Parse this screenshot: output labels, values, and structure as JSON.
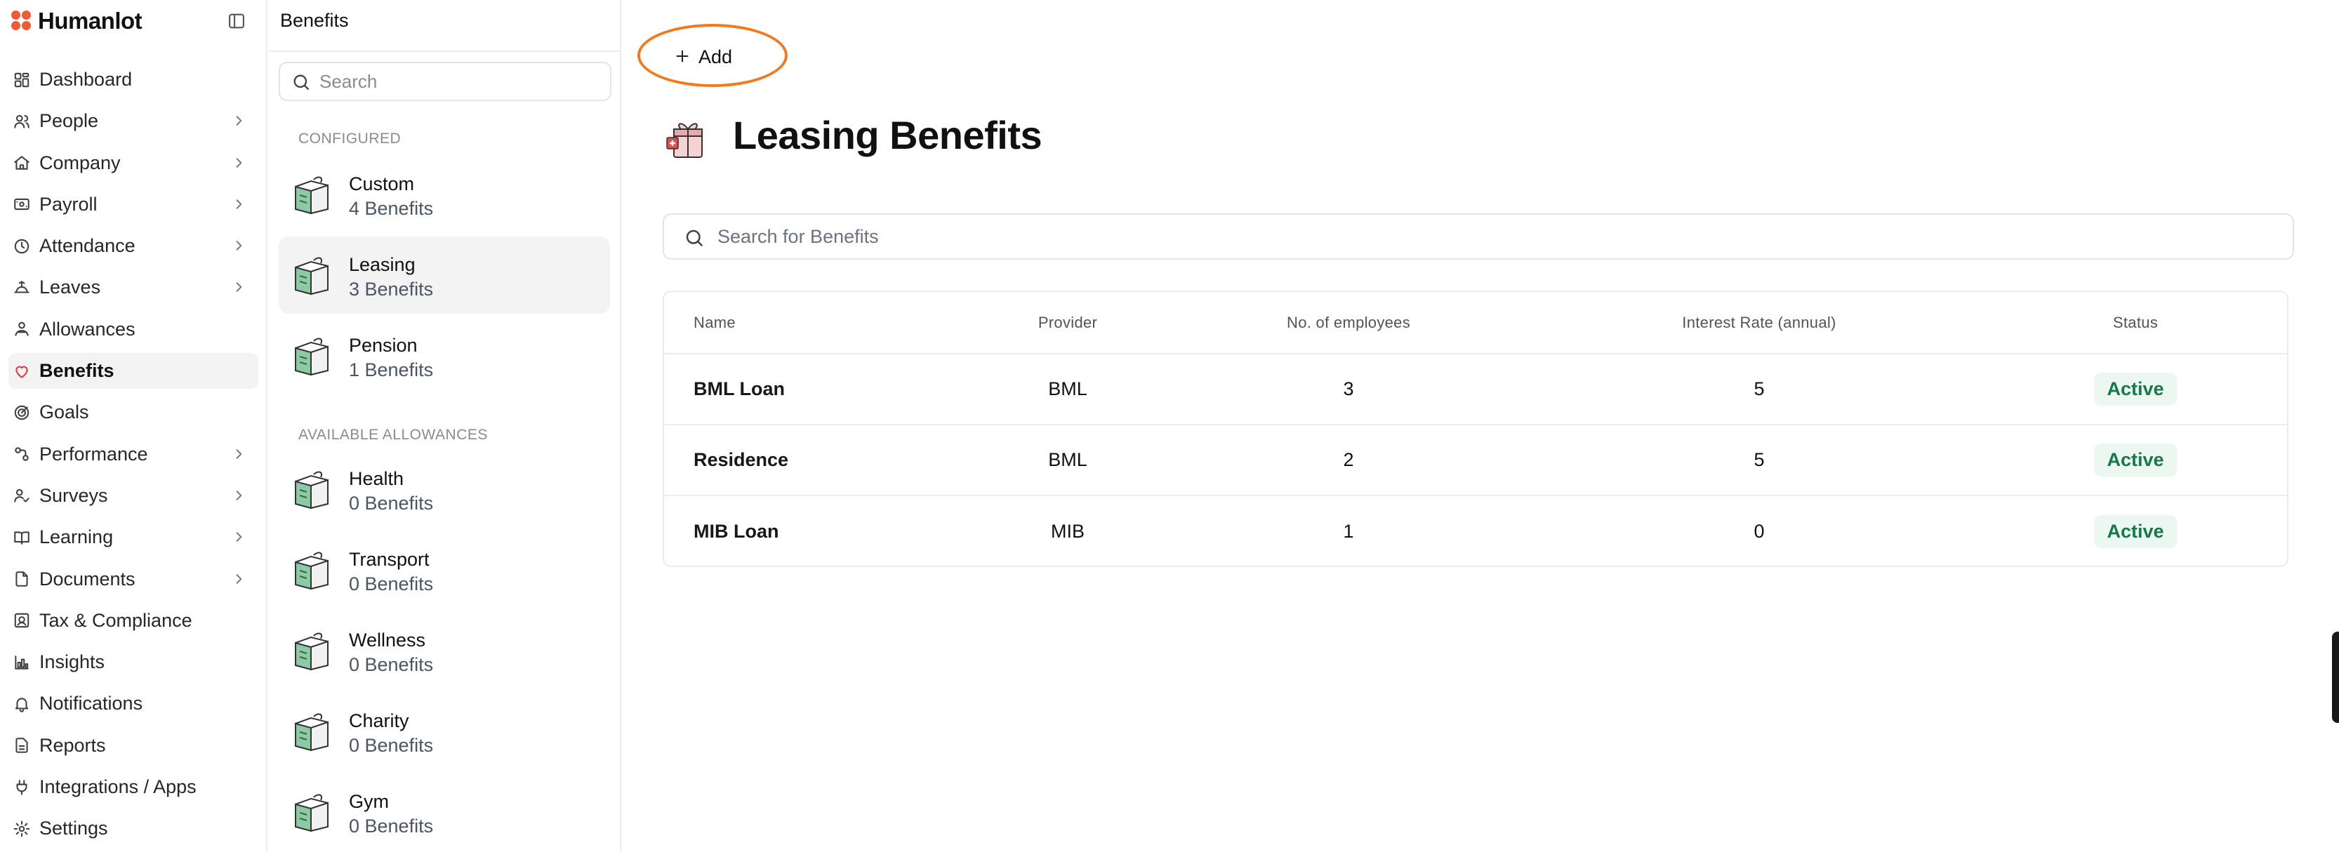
{
  "app": {
    "name": "Humanlot"
  },
  "nav": {
    "items": [
      {
        "label": "Dashboard",
        "icon": "dashboard-icon",
        "chevron": false,
        "active": false
      },
      {
        "label": "People",
        "icon": "people-icon",
        "chevron": true,
        "active": false
      },
      {
        "label": "Company",
        "icon": "company-icon",
        "chevron": true,
        "active": false
      },
      {
        "label": "Payroll",
        "icon": "payroll-icon",
        "chevron": true,
        "active": false
      },
      {
        "label": "Attendance",
        "icon": "clock-icon",
        "chevron": true,
        "active": false
      },
      {
        "label": "Leaves",
        "icon": "leaves-icon",
        "chevron": true,
        "active": false
      },
      {
        "label": "Allowances",
        "icon": "allowances-icon",
        "chevron": false,
        "active": false
      },
      {
        "label": "Benefits",
        "icon": "heart-icon",
        "chevron": false,
        "active": true
      },
      {
        "label": "Goals",
        "icon": "goals-icon",
        "chevron": false,
        "active": false
      },
      {
        "label": "Performance",
        "icon": "performance-icon",
        "chevron": true,
        "active": false
      },
      {
        "label": "Surveys",
        "icon": "surveys-icon",
        "chevron": true,
        "active": false
      },
      {
        "label": "Learning",
        "icon": "book-icon",
        "chevron": true,
        "active": false
      },
      {
        "label": "Documents",
        "icon": "document-icon",
        "chevron": true,
        "active": false
      },
      {
        "label": "Tax & Compliance",
        "icon": "tax-icon",
        "chevron": false,
        "active": false
      },
      {
        "label": "Insights",
        "icon": "insights-icon",
        "chevron": false,
        "active": false
      },
      {
        "label": "Notifications",
        "icon": "bell-icon",
        "chevron": false,
        "active": false
      },
      {
        "label": "Reports",
        "icon": "reports-icon",
        "chevron": false,
        "active": false
      },
      {
        "label": "Integrations / Apps",
        "icon": "plug-icon",
        "chevron": false,
        "active": false
      },
      {
        "label": "Settings",
        "icon": "gear-icon",
        "chevron": false,
        "active": false
      }
    ]
  },
  "panel": {
    "title": "Benefits",
    "search_placeholder": "Search",
    "configured_label": "CONFIGURED",
    "available_label": "AVAILABLE ALLOWANCES",
    "configured": [
      {
        "name": "Custom",
        "count": "4 Benefits",
        "active": false
      },
      {
        "name": "Leasing",
        "count": "3 Benefits",
        "active": true
      },
      {
        "name": "Pension",
        "count": "1 Benefits",
        "active": false
      }
    ],
    "available": [
      {
        "name": "Health",
        "count": "0 Benefits"
      },
      {
        "name": "Transport",
        "count": "0 Benefits"
      },
      {
        "name": "Wellness",
        "count": "0 Benefits"
      },
      {
        "name": "Charity",
        "count": "0 Benefits"
      },
      {
        "name": "Gym",
        "count": "0 Benefits"
      }
    ]
  },
  "main": {
    "add_label": "Add",
    "title": "Leasing Benefits",
    "search_placeholder": "Search for Benefits",
    "table": {
      "headers": {
        "name": "Name",
        "provider": "Provider",
        "employees": "No. of employees",
        "rate": "Interest Rate (annual)",
        "status": "Status"
      },
      "rows": [
        {
          "name": "BML Loan",
          "provider": "BML",
          "employees": "3",
          "rate": "5",
          "status": "Active"
        },
        {
          "name": "Residence",
          "provider": "BML",
          "employees": "2",
          "rate": "5",
          "status": "Active"
        },
        {
          "name": "MIB Loan",
          "provider": "MIB",
          "employees": "1",
          "rate": "0",
          "status": "Active"
        }
      ]
    }
  },
  "colors": {
    "brand": "#f15a36",
    "active_badge_bg": "#ebf7f0",
    "active_badge_text": "#16794a",
    "highlight_ring": "#f07a1c"
  }
}
